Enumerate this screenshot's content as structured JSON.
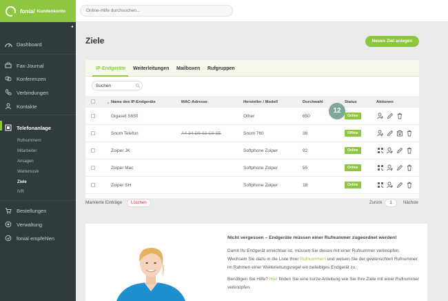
{
  "brand": {
    "name": "fonial",
    "subtitle": "Kundenkonto"
  },
  "topbar": {
    "search_placeholder": "Online-Hilfe durchsuchen..."
  },
  "sidebar": {
    "collapse_glyph": "◂",
    "items": [
      {
        "label": "Dashboard",
        "icon": "dashboard-icon"
      },
      {
        "label": "Fax-Journal",
        "icon": "fax-icon"
      },
      {
        "label": "Konferenzen",
        "icon": "conference-icon"
      },
      {
        "label": "Verbindungen",
        "icon": "phone-icon"
      },
      {
        "label": "Kontakte",
        "icon": "contacts-icon"
      },
      {
        "label": "Telefonanlage",
        "icon": "pbx-icon"
      },
      {
        "label": "Bestellungen",
        "icon": "cart-icon"
      },
      {
        "label": "Verwaltung",
        "icon": "settings-icon"
      },
      {
        "label": "fonial empfehlen",
        "icon": "recommend-icon"
      }
    ],
    "subitems": [
      {
        "label": "Rufnummern"
      },
      {
        "label": "Mitarbeiter"
      },
      {
        "label": "Ansagen"
      },
      {
        "label": "Wartemusik"
      },
      {
        "label": "Ziele"
      },
      {
        "label": "IVR"
      }
    ]
  },
  "page": {
    "title": "Ziele",
    "new_button": "Neues Ziel anlegen"
  },
  "tabs": [
    {
      "label": "IP-Endgeräte"
    },
    {
      "label": "Weiterleitungen"
    },
    {
      "label": "Mailboxen"
    },
    {
      "label": "Rufgruppen"
    }
  ],
  "table": {
    "search_value": "Suchen",
    "sort_glyph": "▲",
    "columns": [
      "Name des IP-Endgeräts",
      "MAC-Adresse",
      "Hersteller / Modell",
      "Durchwahl",
      "Status",
      "Aktionen"
    ],
    "rows": [
      {
        "name": "Gigaset S650",
        "mac": "",
        "model": "Other",
        "ext": "650",
        "status": "Online",
        "status_color": "#8dc63f"
      },
      {
        "name": "Snom Telefon",
        "mac": "A4-34-D9-92-C9-5E",
        "model": "Snom 760",
        "ext": "36",
        "status": "Offline",
        "status_color": "#8dc63f"
      },
      {
        "name": "Zoiper JK",
        "mac": "",
        "model": "Softphone Zoiper",
        "ext": "92",
        "status": "Online",
        "status_color": "#8dc63f"
      },
      {
        "name": "Zoiper Mac",
        "mac": "",
        "model": "Softphone Zoiper",
        "ext": "55",
        "status": "Online",
        "status_color": "#8dc63f"
      },
      {
        "name": "Zoiper SH",
        "mac": "",
        "model": "Softphone Zoiper",
        "ext": "18",
        "status": "Online",
        "status_color": "#8dc63f"
      }
    ],
    "marked_label": "Markierte Einträge",
    "delete_label": "Löschen",
    "pager": {
      "back": "Zurück",
      "page": "1",
      "next": "Nächste"
    }
  },
  "badge": "12",
  "info": {
    "title": "Nicht vergessen – Endgeräte müssen einer Rufnummer zugeordnet werden!",
    "p1a": "Damit Ihr Endgerät erreichbar ist, müssen Sie dieses mit einer Rufnummer verknüpfen.",
    "p1b_pre": "Wechseln Sie dazu in die Liste Ihrer ",
    "p1b_link": "Rufnummern",
    "p1b_post": " und weisen Sie der gewünschten Rufnummer",
    "p1c": "im Rahmen einer Weiterleitungsregel ein beliebiges Endgerät zu.",
    "p2_pre": "Benötigen Sie Hilfe? ",
    "p2_link": "Hier",
    "p2_post": " finden Sie eine kurze Anleitung wie Sie Ihre Ziele mit einer Rufnummer",
    "p2b": "verknüpfen."
  },
  "colors": {
    "accent": "#8dc63f",
    "sidebar": "#2f3b3d",
    "badge": "#7ea796"
  }
}
